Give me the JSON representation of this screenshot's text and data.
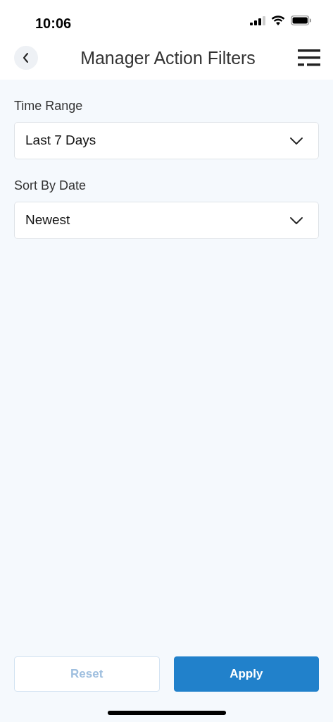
{
  "status_bar": {
    "time": "10:06"
  },
  "header": {
    "title": "Manager Action Filters"
  },
  "filters": [
    {
      "label": "Time Range",
      "value": "Last 7 Days"
    },
    {
      "label": "Sort By Date",
      "value": "Newest"
    }
  ],
  "buttons": [
    {
      "label": "Reset",
      "kind": "secondary",
      "disabled": true
    },
    {
      "label": "Apply",
      "kind": "primary",
      "disabled": false
    }
  ]
}
